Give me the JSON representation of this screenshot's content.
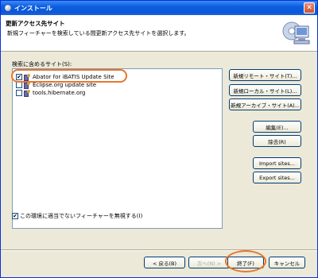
{
  "window": {
    "title": "インストール"
  },
  "header": {
    "title": "更新アクセス先サイト",
    "description": "新規フィーチャーを検索している間更新アクセス先サイトを選択します。"
  },
  "sites": {
    "label": "検索に含めるサイト(S):",
    "items": [
      {
        "label": "Abator for iBATIS Update Site",
        "checked": true
      },
      {
        "label": "Eclipse.org update site",
        "checked": false
      },
      {
        "label": "tools.hibernate.org",
        "checked": false
      }
    ]
  },
  "side_buttons": {
    "new_remote": "新規リモート・サイト(T)...",
    "new_local": "新規ローカル・サイト(L)...",
    "new_archive": "新規アーカイブ・サイト(A)...",
    "edit": "編集(E)...",
    "remove": "除去(R)",
    "import": "Import sites...",
    "export": "Export sites..."
  },
  "options": {
    "ignore_label": "この環境に適当でないフィーチャーを無視する(I)",
    "ignore_checked": true
  },
  "nav": {
    "back": "< 戻る(B)",
    "next": "次へ(N) >",
    "finish": "終了(F)",
    "cancel": "キャンセル"
  }
}
